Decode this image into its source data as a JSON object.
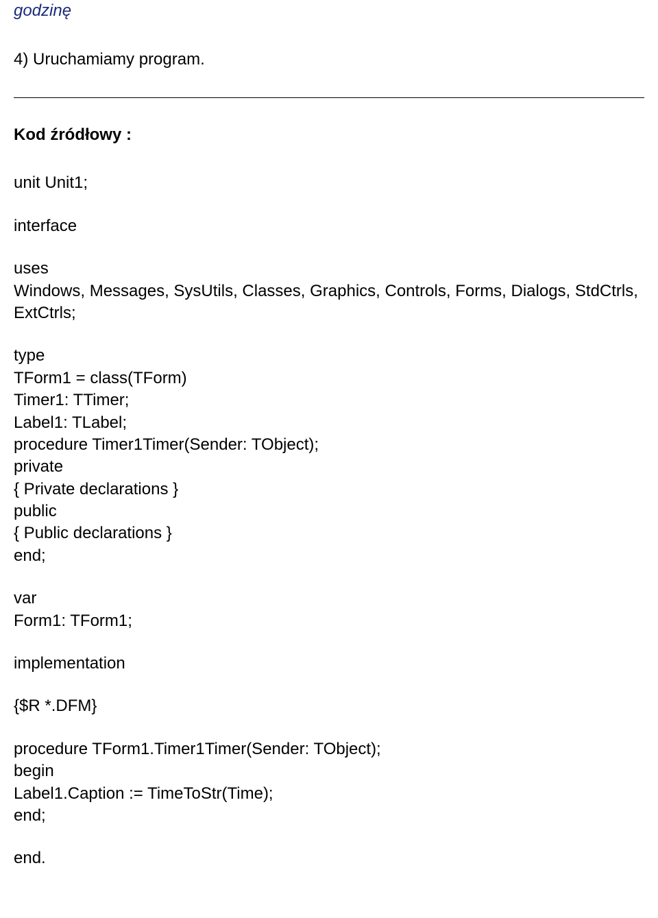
{
  "doc": {
    "comment": "godzinę",
    "step4": "4) Uruchamiamy program.",
    "heading": "Kod źródłowy :",
    "p1": "unit Unit1;",
    "p2": "interface",
    "p3": "uses\nWindows, Messages, SysUtils, Classes, Graphics, Controls, Forms, Dialogs, StdCtrls, ExtCtrls;",
    "p4": "type\nTForm1 = class(TForm)\nTimer1: TTimer;\nLabel1: TLabel;\nprocedure Timer1Timer(Sender: TObject);\nprivate\n{ Private declarations }\npublic\n{ Public declarations }\nend;",
    "p5": "var\nForm1: TForm1;",
    "p6": "implementation",
    "p7": "{$R *.DFM}",
    "p8": "procedure TForm1.Timer1Timer(Sender: TObject);\nbegin\nLabel1.Caption := TimeToStr(Time);\nend;",
    "p9": "end."
  }
}
